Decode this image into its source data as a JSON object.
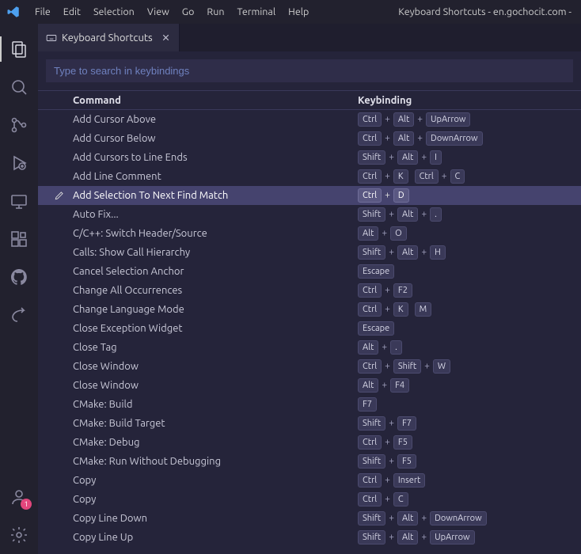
{
  "window": {
    "title": "Keyboard Shortcuts - en.gochocit.com -"
  },
  "menubar": {
    "items": [
      "File",
      "Edit",
      "Selection",
      "View",
      "Go",
      "Run",
      "Terminal",
      "Help"
    ]
  },
  "activitybar": {
    "icons": [
      {
        "name": "explorer-icon",
        "active": true
      },
      {
        "name": "search-icon"
      },
      {
        "name": "source-control-icon"
      },
      {
        "name": "run-debug-icon"
      },
      {
        "name": "remote-explorer-icon"
      },
      {
        "name": "extensions-icon"
      },
      {
        "name": "github-icon"
      },
      {
        "name": "share-icon"
      }
    ],
    "bottom": [
      {
        "name": "account-icon",
        "badge": "1"
      },
      {
        "name": "settings-gear-icon"
      }
    ]
  },
  "tab": {
    "label": "Keyboard Shortcuts"
  },
  "search": {
    "placeholder": "Type to search in keybindings"
  },
  "columns": {
    "command": "Command",
    "keybinding": "Keybinding"
  },
  "rows": [
    {
      "command": "Add Cursor Above",
      "keys": [
        [
          "Ctrl",
          "Alt",
          "UpArrow"
        ]
      ]
    },
    {
      "command": "Add Cursor Below",
      "keys": [
        [
          "Ctrl",
          "Alt",
          "DownArrow"
        ]
      ]
    },
    {
      "command": "Add Cursors to Line Ends",
      "keys": [
        [
          "Shift",
          "Alt",
          "I"
        ]
      ]
    },
    {
      "command": "Add Line Comment",
      "keys": [
        [
          "Ctrl",
          "K"
        ],
        [
          "Ctrl",
          "C"
        ]
      ]
    },
    {
      "command": "Add Selection To Next Find Match",
      "keys": [
        [
          "Ctrl",
          "D"
        ]
      ],
      "selected": true
    },
    {
      "command": "Auto Fix...",
      "keys": [
        [
          "Shift",
          "Alt",
          "."
        ]
      ]
    },
    {
      "command": "C/C++: Switch Header/Source",
      "keys": [
        [
          "Alt",
          "O"
        ]
      ]
    },
    {
      "command": "Calls: Show Call Hierarchy",
      "keys": [
        [
          "Shift",
          "Alt",
          "H"
        ]
      ]
    },
    {
      "command": "Cancel Selection Anchor",
      "keys": [
        [
          "Escape"
        ]
      ]
    },
    {
      "command": "Change All Occurrences",
      "keys": [
        [
          "Ctrl",
          "F2"
        ]
      ]
    },
    {
      "command": "Change Language Mode",
      "keys": [
        [
          "Ctrl",
          "K"
        ],
        [
          "M"
        ]
      ]
    },
    {
      "command": "Close Exception Widget",
      "keys": [
        [
          "Escape"
        ]
      ]
    },
    {
      "command": "Close Tag",
      "keys": [
        [
          "Alt",
          "."
        ]
      ]
    },
    {
      "command": "Close Window",
      "keys": [
        [
          "Ctrl",
          "Shift",
          "W"
        ]
      ]
    },
    {
      "command": "Close Window",
      "keys": [
        [
          "Alt",
          "F4"
        ]
      ]
    },
    {
      "command": "CMake: Build",
      "keys": [
        [
          "F7"
        ]
      ]
    },
    {
      "command": "CMake: Build Target",
      "keys": [
        [
          "Shift",
          "F7"
        ]
      ]
    },
    {
      "command": "CMake: Debug",
      "keys": [
        [
          "Ctrl",
          "F5"
        ]
      ]
    },
    {
      "command": "CMake: Run Without Debugging",
      "keys": [
        [
          "Shift",
          "F5"
        ]
      ]
    },
    {
      "command": "Copy",
      "keys": [
        [
          "Ctrl",
          "Insert"
        ]
      ]
    },
    {
      "command": "Copy",
      "keys": [
        [
          "Ctrl",
          "C"
        ]
      ]
    },
    {
      "command": "Copy Line Down",
      "keys": [
        [
          "Shift",
          "Alt",
          "DownArrow"
        ]
      ]
    },
    {
      "command": "Copy Line Up",
      "keys": [
        [
          "Shift",
          "Alt",
          "UpArrow"
        ]
      ]
    }
  ]
}
